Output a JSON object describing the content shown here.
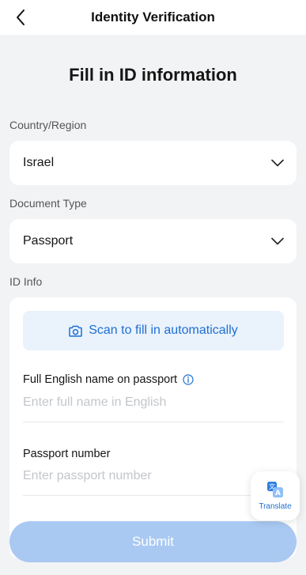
{
  "header": {
    "title": "Identity Verification",
    "back_icon": "chevron-left-icon"
  },
  "main": {
    "page_title": "Fill in ID information",
    "country": {
      "label": "Country/Region",
      "value": "Israel"
    },
    "document_type": {
      "label": "Document Type",
      "value": "Passport"
    },
    "id_info": {
      "label": "ID Info",
      "scan_button": {
        "label": "Scan to fill in automatically",
        "icon": "camera-icon"
      },
      "full_name": {
        "label": "Full English name on passport",
        "placeholder": "Enter full name in English",
        "value": "",
        "info_icon": "info-icon"
      },
      "passport_number": {
        "label": "Passport number",
        "placeholder": "Enter passport number",
        "value": ""
      }
    },
    "submit_label": "Submit"
  },
  "floating": {
    "translate_label": "Translate",
    "icon": "translate-icon"
  },
  "colors": {
    "accent": "#1d6fd1",
    "submit_disabled": "#a9c9f2",
    "scan_bg": "#eaf2fc",
    "background": "#f2f3f5"
  }
}
